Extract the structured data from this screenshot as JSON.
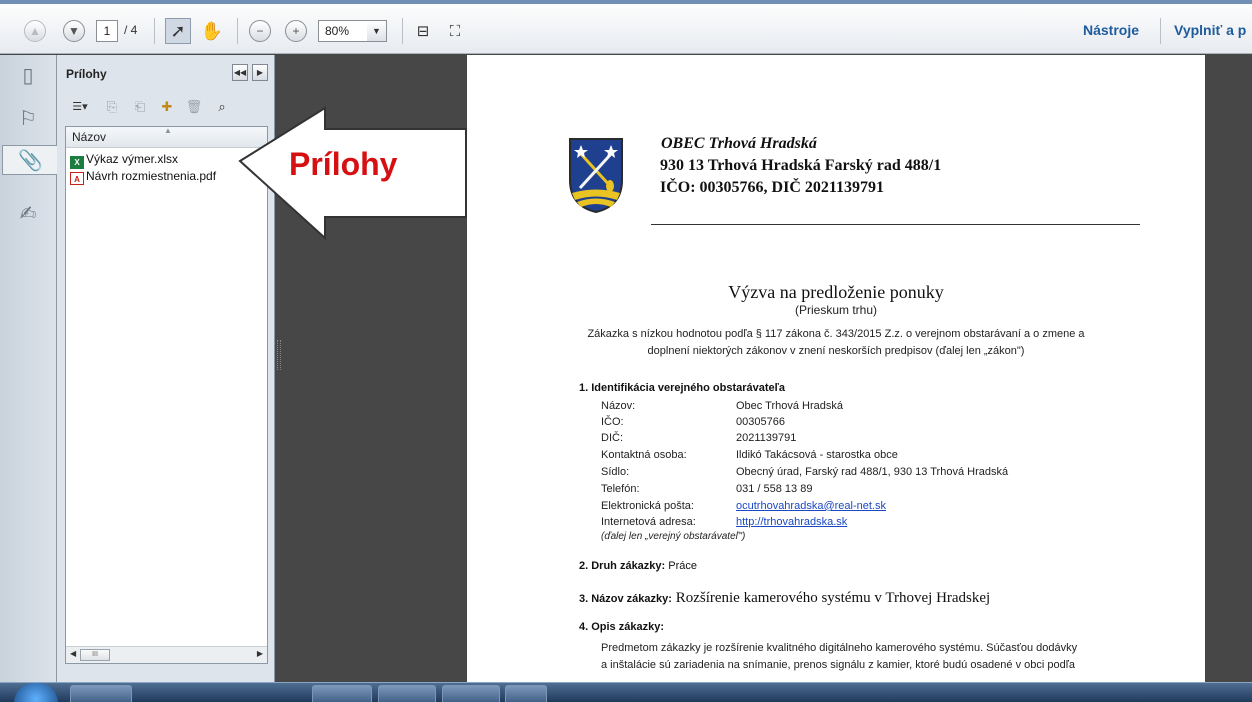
{
  "toolbar": {
    "page_current": "1",
    "page_total": "/ 4",
    "zoom": "80%",
    "tools_link": "Nástroje",
    "fill_link": "Vyplniť a p"
  },
  "panel": {
    "title": "Prílohy",
    "column_header": "Názov",
    "files": [
      {
        "name": "Výkaz výmer.xlsx",
        "type": "xlsx"
      },
      {
        "name": "Návrh rozmiestnenia.pdf",
        "type": "pdf"
      }
    ],
    "scroll_thumb": "III"
  },
  "callout": {
    "label": "Prílohy",
    "fill": "#ffffff",
    "stroke": "#333333",
    "label_color": "#d60f12"
  },
  "document": {
    "org": "OBEC Trhová Hradská",
    "address": "930 13 Trhová Hradská Farský rad 488/1",
    "ids": "IČO: 00305766,   DIČ 2021139791",
    "title": "Výzva na predloženie ponuky",
    "subtitle": "(Prieskum trhu)",
    "intro_line1": "Zákazka s nízkou hodnotou podľa § 117 zákona č. 343/2015 Z.z. o verejnom obstarávaní a o zmene a",
    "intro_line2": "doplnení niektorých zákonov v znení neskorších predpisov (ďalej len „zákon\")",
    "section1": {
      "heading": "1.   Identifikácia verejného obstarávateľa",
      "rows": [
        {
          "key": "Názov:",
          "value": "Obec Trhová Hradská"
        },
        {
          "key": "IČO:",
          "value": "00305766"
        },
        {
          "key": "DIČ:",
          "value": "2021139791"
        },
        {
          "key": "Kontaktná osoba:",
          "value": "Ildikó Takácsová - starostka obce"
        },
        {
          "key": "Sídlo:",
          "value": "Obecný úrad, Farský rad 488/1, 930 13 Trhová Hradská"
        },
        {
          "key": "Telefón:",
          "value": "031 / 558 13 89"
        },
        {
          "key": "Elektronická pošta:",
          "value": "ocutrhovahradska@real-net.sk"
        },
        {
          "key": "Internetová adresa:",
          "value": "http://trhovahradska.sk"
        }
      ],
      "note": "(ďalej len „verejný obstarávateľ\")"
    },
    "section2": {
      "heading": "2.   Druh zákazky:",
      "value": " Práce"
    },
    "section3": {
      "heading": "3.   Názov zákazky:",
      "value": " Rozšírenie kamerového systému v Trhovej Hradskej"
    },
    "section4": {
      "heading": "4.   Opis zákazky:",
      "line1": "Predmetom zákazky je rozšírenie kvalitného digitálneho kamerového systému. Súčasťou dodávky",
      "line2": "a inštalácie sú zariadenia na snímanie, prenos signálu z kamier, ktoré budú osadené v obci podľa"
    }
  }
}
